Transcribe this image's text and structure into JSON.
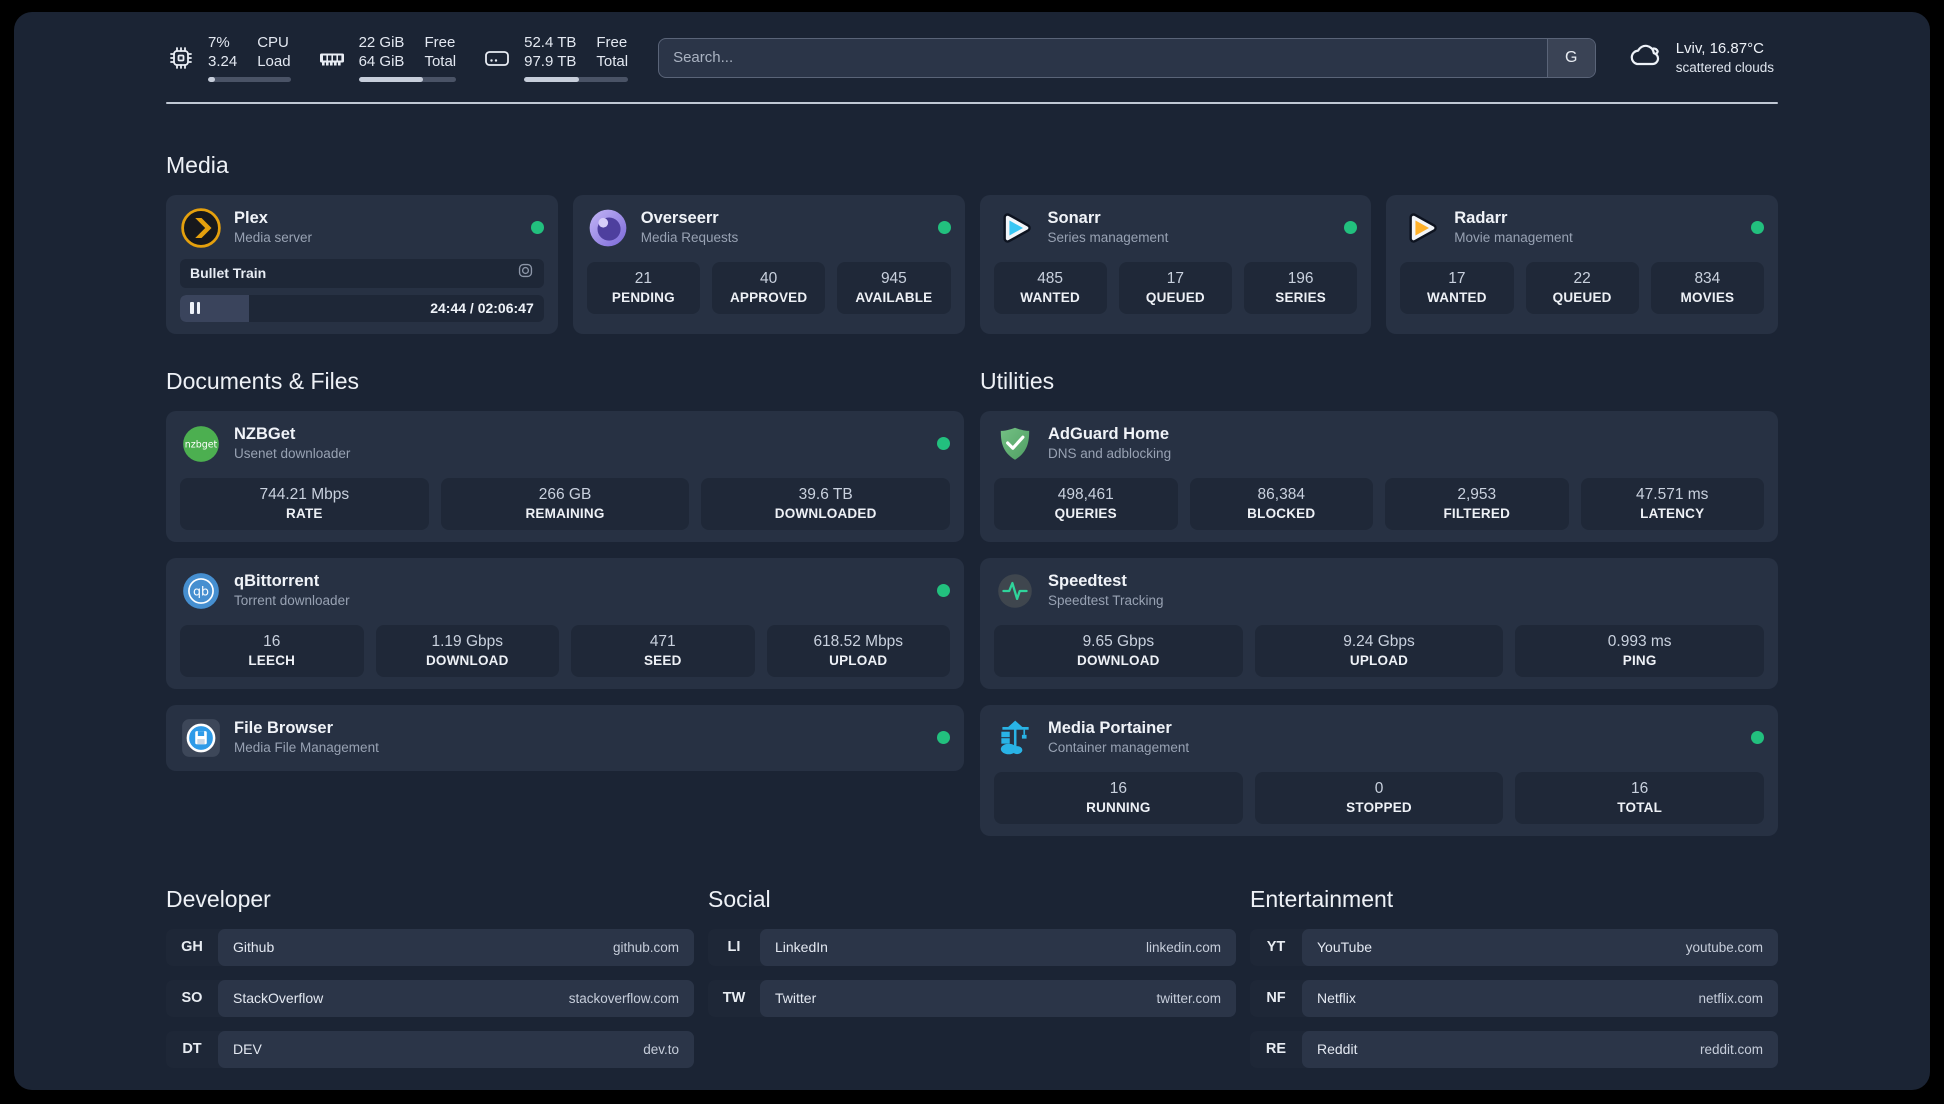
{
  "colors": {
    "status_online": "#22c07e",
    "plex_brand": "#e5a00d",
    "sonarr_brand": "#38c6f4",
    "radarr_brand": "#ffb12a",
    "overseerr_brand": "#8a78dd",
    "nzbget_brand": "#4caf50",
    "qbittorrent_brand": "#468fd0",
    "adguard_brand": "#67b279",
    "portainer_brand": "#29b3e6"
  },
  "topbar": {
    "cpu": {
      "usage": "7%",
      "load": "3.24",
      "label_line1": "CPU",
      "label_line2": "Load",
      "bar_percent": 9
    },
    "memory": {
      "free": "22 GiB",
      "total": "64 GiB",
      "label_line1": "Free",
      "label_line2": "Total",
      "bar_percent": 66
    },
    "disk": {
      "free": "52.4 TB",
      "total": "97.9 TB",
      "label_line1": "Free",
      "label_line2": "Total",
      "bar_percent": 53
    },
    "search": {
      "placeholder": "Search...",
      "engine_button": "G"
    },
    "weather": {
      "location": "Lviv, 16.87°C",
      "condition": "scattered clouds"
    }
  },
  "sections": {
    "media": "Media",
    "documents": "Documents & Files",
    "utilities": "Utilities",
    "developer": "Developer",
    "social": "Social",
    "entertainment": "Entertainment"
  },
  "apps": {
    "plex": {
      "name": "Plex",
      "subtitle": "Media server",
      "now_playing": "Bullet Train",
      "time_display": "24:44 / 02:06:47",
      "progress_percent": 19
    },
    "overseerr": {
      "name": "Overseerr",
      "subtitle": "Media Requests",
      "stats": [
        {
          "value": "21",
          "label": "PENDING"
        },
        {
          "value": "40",
          "label": "APPROVED"
        },
        {
          "value": "945",
          "label": "AVAILABLE"
        }
      ]
    },
    "sonarr": {
      "name": "Sonarr",
      "subtitle": "Series management",
      "stats": [
        {
          "value": "485",
          "label": "WANTED"
        },
        {
          "value": "17",
          "label": "QUEUED"
        },
        {
          "value": "196",
          "label": "SERIES"
        }
      ]
    },
    "radarr": {
      "name": "Radarr",
      "subtitle": "Movie management",
      "stats": [
        {
          "value": "17",
          "label": "WANTED"
        },
        {
          "value": "22",
          "label": "QUEUED"
        },
        {
          "value": "834",
          "label": "MOVIES"
        }
      ]
    },
    "nzbget": {
      "name": "NZBGet",
      "subtitle": "Usenet downloader",
      "stats": [
        {
          "value": "744.21 Mbps",
          "label": "RATE"
        },
        {
          "value": "266 GB",
          "label": "REMAINING"
        },
        {
          "value": "39.6 TB",
          "label": "DOWNLOADED"
        }
      ]
    },
    "qbittorrent": {
      "name": "qBittorrent",
      "subtitle": "Torrent downloader",
      "stats": [
        {
          "value": "16",
          "label": "LEECH"
        },
        {
          "value": "1.19 Gbps",
          "label": "DOWNLOAD"
        },
        {
          "value": "471",
          "label": "SEED"
        },
        {
          "value": "618.52 Mbps",
          "label": "UPLOAD"
        }
      ]
    },
    "filebrowser": {
      "name": "File Browser",
      "subtitle": "Media File Management"
    },
    "adguard": {
      "name": "AdGuard Home",
      "subtitle": "DNS and adblocking",
      "stats": [
        {
          "value": "498,461",
          "label": "QUERIES"
        },
        {
          "value": "86,384",
          "label": "BLOCKED"
        },
        {
          "value": "2,953",
          "label": "FILTERED"
        },
        {
          "value": "47.571 ms",
          "label": "LATENCY"
        }
      ]
    },
    "speedtest": {
      "name": "Speedtest",
      "subtitle": "Speedtest Tracking",
      "stats": [
        {
          "value": "9.65 Gbps",
          "label": "DOWNLOAD"
        },
        {
          "value": "9.24 Gbps",
          "label": "UPLOAD"
        },
        {
          "value": "0.993 ms",
          "label": "PING"
        }
      ]
    },
    "portainer": {
      "name": "Media Portainer",
      "subtitle": "Container management",
      "stats": [
        {
          "value": "16",
          "label": "RUNNING"
        },
        {
          "value": "0",
          "label": "STOPPED"
        },
        {
          "value": "16",
          "label": "TOTAL"
        }
      ]
    }
  },
  "bookmarks": {
    "developer": [
      {
        "abbr": "GH",
        "name": "Github",
        "url": "github.com"
      },
      {
        "abbr": "SO",
        "name": "StackOverflow",
        "url": "stackoverflow.com"
      },
      {
        "abbr": "DT",
        "name": "DEV",
        "url": "dev.to"
      }
    ],
    "social": [
      {
        "abbr": "LI",
        "name": "LinkedIn",
        "url": "linkedin.com"
      },
      {
        "abbr": "TW",
        "name": "Twitter",
        "url": "twitter.com"
      }
    ],
    "entertainment": [
      {
        "abbr": "YT",
        "name": "YouTube",
        "url": "youtube.com"
      },
      {
        "abbr": "NF",
        "name": "Netflix",
        "url": "netflix.com"
      },
      {
        "abbr": "RE",
        "name": "Reddit",
        "url": "reddit.com"
      }
    ]
  }
}
